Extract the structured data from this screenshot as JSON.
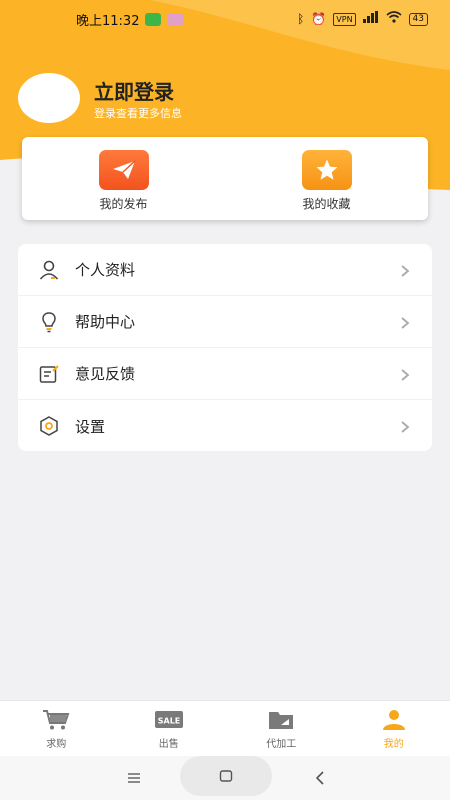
{
  "status_bar": {
    "time": "晚上11:32",
    "vpn": "VPN",
    "battery": "43",
    "icons": [
      "wechat-icon",
      "app-notification-icon",
      "bluetooth-icon",
      "alarm-icon",
      "vpn-icon",
      "signal-icon",
      "wifi-icon",
      "battery-icon"
    ]
  },
  "profile": {
    "title": "立即登录",
    "subtitle": "登录查看更多信息"
  },
  "quick_actions": [
    {
      "label": "我的发布",
      "icon": "paper-plane-icon"
    },
    {
      "label": "我的收藏",
      "icon": "star-icon"
    }
  ],
  "menu": [
    {
      "label": "个人资料",
      "icon": "person-icon"
    },
    {
      "label": "帮助中心",
      "icon": "lightbulb-icon"
    },
    {
      "label": "意见反馈",
      "icon": "feedback-icon"
    },
    {
      "label": "设置",
      "icon": "settings-icon"
    }
  ],
  "tabs": [
    {
      "label": "求购",
      "icon": "cart-icon",
      "active": false
    },
    {
      "label": "出售",
      "icon": "sale-icon",
      "active": false
    },
    {
      "label": "代加工",
      "icon": "folder-icon",
      "active": false
    },
    {
      "label": "我的",
      "icon": "user-icon",
      "active": true
    }
  ],
  "colors": {
    "accent": "#fcb426",
    "active_tab": "#f6a81a",
    "publish_icon": "#f3531e",
    "favorite_icon": "#f69214"
  }
}
